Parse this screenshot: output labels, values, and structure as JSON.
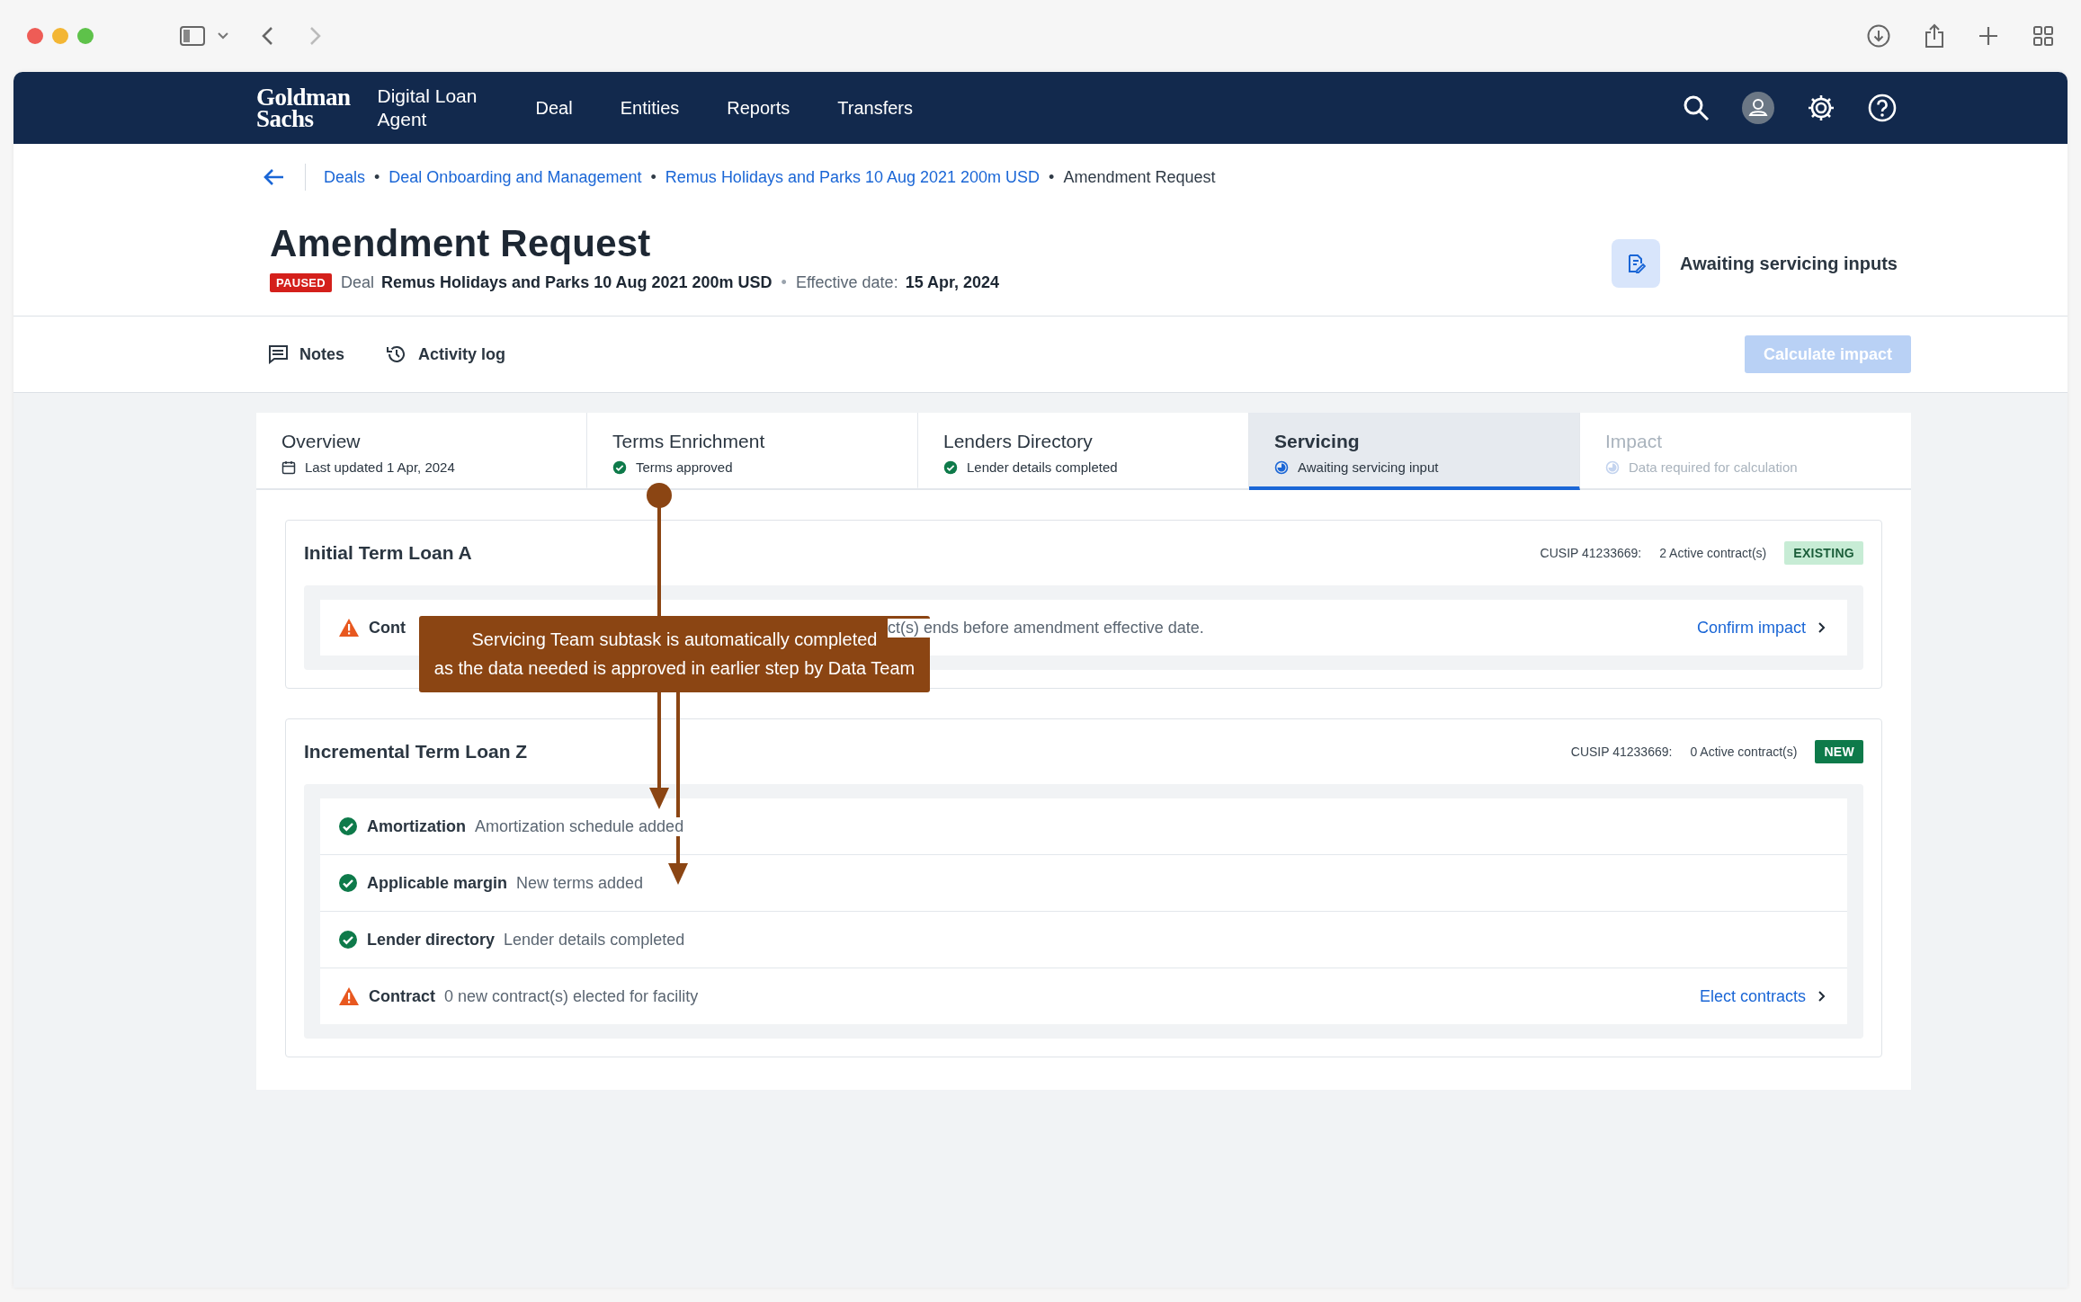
{
  "nav": {
    "logo": [
      "Goldman",
      "Sachs"
    ],
    "app_name": "Digital Loan Agent",
    "links": [
      {
        "label": "Deal"
      },
      {
        "label": "Entities"
      },
      {
        "label": "Reports"
      },
      {
        "label": "Transfers"
      }
    ]
  },
  "breadcrumb": {
    "separator": "•",
    "items": [
      {
        "label": "Deals",
        "kind": "link"
      },
      {
        "label": "Deal Onboarding and Management",
        "kind": "link"
      },
      {
        "label": "Remus Holidays and Parks 10 Aug 2021 200m USD",
        "kind": "link"
      },
      {
        "label": "Amendment Request",
        "kind": "current"
      }
    ]
  },
  "header": {
    "title": "Amendment Request",
    "status_badge": "PAUSED",
    "deal_label": "Deal",
    "deal_name": "Remus Holidays and Parks 10 Aug 2021 200m USD",
    "separator": "•",
    "date_label": "Effective date:",
    "date": "15 Apr, 2024",
    "state": "Awaiting servicing inputs"
  },
  "toolbar": {
    "actions": [
      {
        "label": "Notes",
        "kind": "notes"
      },
      {
        "label": "Activity log",
        "kind": "history"
      }
    ],
    "primary": {
      "label": "Calculate impact",
      "disabled": true
    }
  },
  "tabs": [
    {
      "title": "Overview",
      "subtitle": "Last updated 1 Apr, 2024",
      "kind": "date",
      "selected": false,
      "disabled": false
    },
    {
      "title": "Terms Enrichment",
      "subtitle": "Terms approved",
      "kind": "done",
      "selected": false,
      "disabled": false
    },
    {
      "title": "Lenders Directory",
      "subtitle": "Lender details completed",
      "kind": "done",
      "selected": false,
      "disabled": false
    },
    {
      "title": "Servicing",
      "subtitle": "Awaiting servicing input",
      "kind": "progress",
      "selected": true,
      "disabled": false
    },
    {
      "title": "Impact",
      "subtitle": "Data required for calculation",
      "kind": "progress",
      "selected": false,
      "disabled": true
    }
  ],
  "facilities": [
    {
      "name": "Initial Term Loan A",
      "cusip": "CUSIP 41233669:",
      "contracts": "2 Active contract(s)",
      "badge": {
        "label": "EXISTING",
        "kind": "existing"
      },
      "items": [
        {
          "kind": "warning",
          "label": "Cont",
          "description": "ct(s) ends before amendment effective date.",
          "action": "Confirm impact"
        }
      ]
    },
    {
      "name": "Incremental Term Loan Z",
      "cusip": "CUSIP 41233669:",
      "contracts": "0 Active contract(s)",
      "badge": {
        "label": "NEW",
        "kind": "new"
      },
      "items": [
        {
          "kind": "done",
          "label": "Amortization",
          "description": "Amortization schedule added"
        },
        {
          "kind": "done",
          "label": "Applicable margin",
          "description": "New terms added"
        },
        {
          "kind": "done",
          "label": "Lender directory",
          "description": "Lender details completed"
        },
        {
          "kind": "warning",
          "label": "Contract",
          "description": "0 new contract(s) elected for facility",
          "action": "Elect contracts"
        }
      ]
    }
  ],
  "annotation": {
    "text": "Servicing Team subtask is automatically completed\nas the data needed is approved in earlier step by Data Team"
  }
}
